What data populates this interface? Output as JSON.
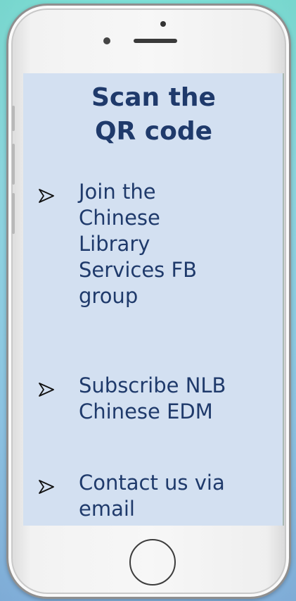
{
  "screen": {
    "title_lines": [
      "Scan the",
      "QR code"
    ],
    "items": [
      {
        "icon": "arrow-bullet-icon",
        "text": "Join the\nChinese\nLibrary\nServices FB\ngroup"
      },
      {
        "icon": "arrow-bullet-icon",
        "text": "Subscribe NLB\nChinese EDM"
      },
      {
        "icon": "arrow-bullet-icon",
        "text": "Contact us via\nemail"
      }
    ]
  },
  "colors": {
    "text": "#1f3a6b",
    "screen_bg": "#d3e0f1",
    "background": "#8fd9e2"
  }
}
